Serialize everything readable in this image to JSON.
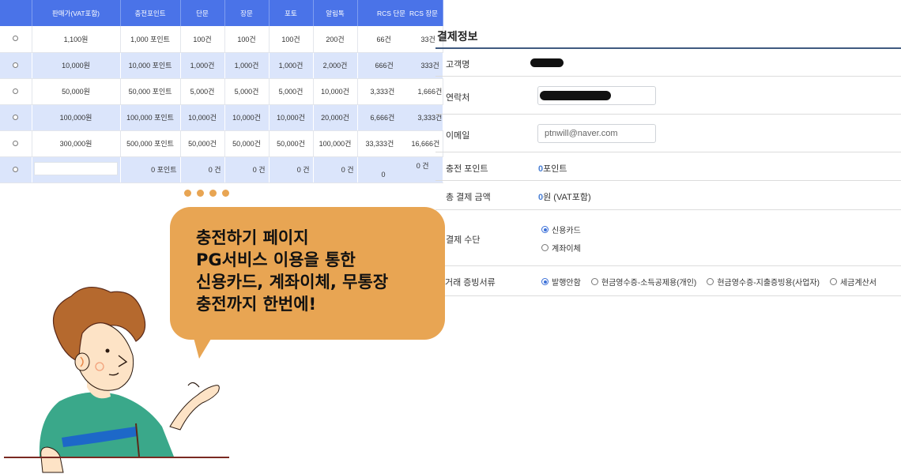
{
  "price_table": {
    "headers": [
      "판매가(VAT포함)",
      "충전포인트",
      "단문",
      "장문",
      "포토",
      "알림톡",
      "RCS 단문",
      "RCS 장문"
    ],
    "rows": [
      [
        "1,100원",
        "1,000 포인트",
        "100건",
        "100건",
        "100건",
        "200건",
        "66건",
        "33건"
      ],
      [
        "10,000원",
        "10,000 포인트",
        "1,000건",
        "1,000건",
        "1,000건",
        "2,000건",
        "666건",
        "333건"
      ],
      [
        "50,000원",
        "50,000 포인트",
        "5,000건",
        "5,000건",
        "5,000건",
        "10,000건",
        "3,333건",
        "1,666건"
      ],
      [
        "100,000원",
        "100,000 포인트",
        "10,000건",
        "10,000건",
        "10,000건",
        "20,000건",
        "6,666건",
        "3,333건"
      ],
      [
        "300,000원",
        "500,000 포인트",
        "50,000건",
        "50,000건",
        "50,000건",
        "100,000건",
        "33,333건",
        "16,666건"
      ]
    ],
    "custom_row": [
      "0 포인트",
      "0 건",
      "0 건",
      "0 건",
      "0 건",
      "0 건",
      "0"
    ]
  },
  "payment": {
    "title": "결제정보",
    "customer_label": "고객명",
    "phone_label": "연락처",
    "email_label": "이메일",
    "email_value": "ptnwill@naver.com",
    "points_label": "충전 포인트",
    "points_value": "0",
    "points_unit": "포인트",
    "total_label": "총 결제 금액",
    "total_value": "0",
    "total_unit": "원 (VAT포함)",
    "method_label": "결제 수단",
    "method_options": [
      "신용카드",
      "계좌이체"
    ],
    "receipt_label": "거래 증빙서류",
    "receipt_options": [
      "발행안함",
      "현금영수증-소득공제용(개인)",
      "현금영수증-지출증빙용(사업자)",
      "세금계산서"
    ]
  },
  "bubble": {
    "lines": [
      "충전하기 페이지",
      "PG서비스 이용을 통한",
      "신용카드, 계좌이체, 무통장",
      "충전까지 한번에!"
    ]
  },
  "colors": {
    "table_header": "#4a73e8",
    "row_alt": "#dbe5fb",
    "bubble": "#e8a553",
    "accent_blue": "#4a7fd4",
    "shirt": "#3aa88a"
  }
}
